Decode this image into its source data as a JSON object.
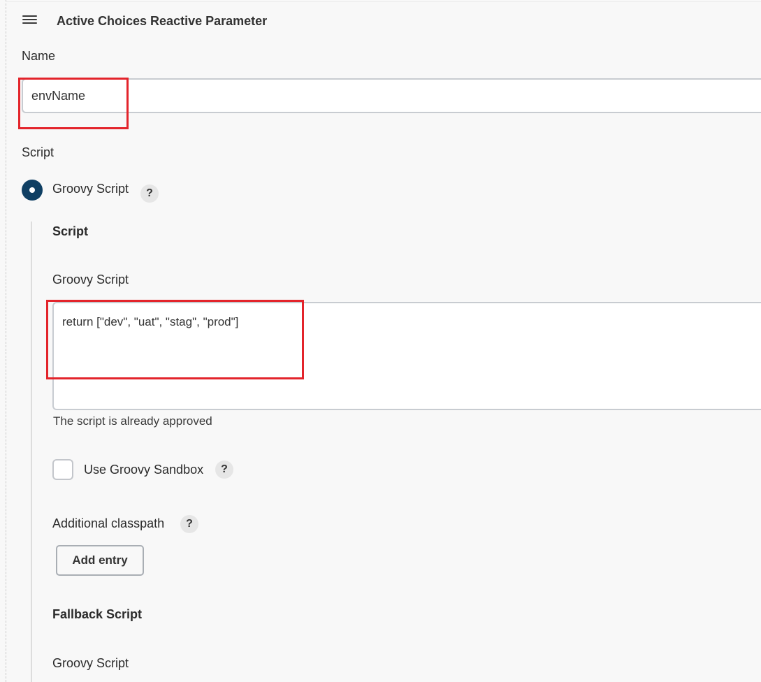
{
  "header": {
    "title": "Active Choices Reactive Parameter",
    "handle_icon": "drag-handle-icon"
  },
  "name_field": {
    "label": "Name",
    "value": "envName"
  },
  "script_section": {
    "label": "Script",
    "radio_option": {
      "label": "Groovy Script",
      "selected": true
    },
    "help_glyph": "?",
    "subsection_title": "Script",
    "groovy_script_label": "Groovy Script",
    "groovy_script_value": "return [\"dev\", \"uat\", \"stag\", \"prod\"]",
    "approval_status": "The script is already approved",
    "sandbox": {
      "label": "Use Groovy Sandbox",
      "checked": false
    },
    "classpath": {
      "label": "Additional classpath",
      "add_button": "Add entry"
    },
    "fallback": {
      "title": "Fallback Script",
      "groovy_script_label": "Groovy Script"
    }
  },
  "colors": {
    "highlight": "#e3242b",
    "radio_accent": "#0f3f63",
    "background": "#f8f8f8"
  }
}
